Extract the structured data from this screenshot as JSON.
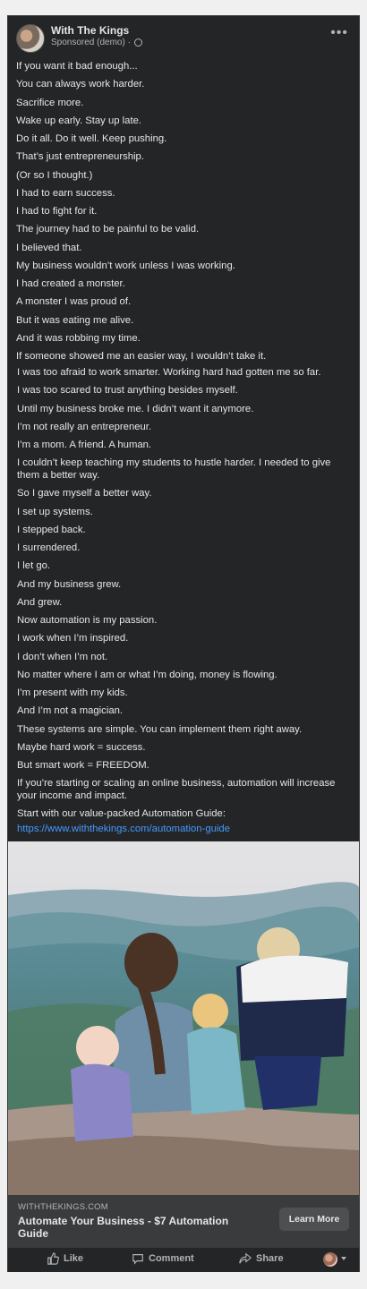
{
  "post": {
    "page_name": "With The Kings",
    "sponsored_label": "Sponsored (demo) ·",
    "more_label": "•••",
    "lines_a": [
      "If you want it bad enough...",
      "You can always work harder.",
      "Sacrifice more.",
      "Wake up early. Stay up late.",
      "Do it all. Do it well. Keep pushing.",
      "That’s just entrepreneurship.",
      "(Or so I thought.)",
      "I had to earn success.",
      "I had to fight for it.",
      "The journey had to be painful to be valid.",
      "I believed that.",
      "My business wouldn’t work unless I was working.",
      "I had created a monster.",
      "A monster I was proud of.",
      "But it was eating me alive.",
      "And it was robbing my time.",
      "If someone showed me an easier way, I wouldn’t take it."
    ],
    "lines_b": [
      "I was too afraid to work smarter. Working hard had gotten me so far.",
      "I was too scared to trust anything besides myself.",
      "Until my business broke me. I didn’t want it anymore.",
      "I’m not really an entrepreneur.",
      "I’m a mom. A friend. A human.",
      "I couldn’t keep teaching my students to hustle harder. I needed to give them a better way.",
      "So I gave myself a better way.",
      "I set up systems.",
      "I stepped back.",
      "I surrendered.",
      "I let go.",
      "And my business grew.",
      "And grew.",
      "Now automation is my passion.",
      "I work when I’m inspired.",
      "I don’t when I’m not.",
      "No matter where I am or what I’m doing, money is flowing.",
      "I’m present with my kids.",
      "And I’m not a magician.",
      "These systems are simple. You can implement them right away.",
      "Maybe hard work = success.",
      "But smart work = FREEDOM.",
      "If you’re starting or scaling an online business, automation will increase your income and impact.",
      "Start with our value-packed Automation Guide:"
    ],
    "link": "https://www.withthekings.com/automation-guide"
  },
  "ad": {
    "domain": "WITHTHEKINGS.COM",
    "title": "Automate Your Business - $7 Automation Guide",
    "cta": "Learn More"
  },
  "actions": {
    "like": "Like",
    "comment": "Comment",
    "share": "Share"
  },
  "colors": {
    "card_bg": "#242526",
    "text": "#e4e6eb",
    "secondary": "#b0b3b8",
    "link": "#4599ff"
  }
}
